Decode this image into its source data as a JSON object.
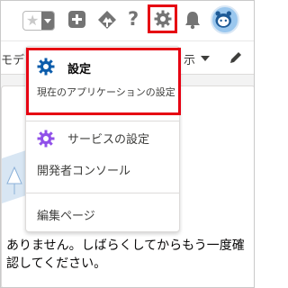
{
  "header": {
    "favorites_icon": "star-icon",
    "favorites_menu_icon": "chevron-down-icon",
    "global_actions_icon": "plus-icon",
    "trailhead_icon": "trailhead-icon",
    "help_icon": "question-icon",
    "help_glyph": "?",
    "setup_icon": "gear-icon",
    "notifications_icon": "bell-icon",
    "avatar_icon": "astro-avatar-icon"
  },
  "nav": {
    "left_label": "モデー",
    "right_label": "示",
    "edit_icon": "pencil-icon"
  },
  "setup_menu": {
    "items": [
      {
        "label": "設定",
        "description": "現在のアプリケーションの設定",
        "icon": "gear-icon",
        "icon_color": "#0b5cab"
      },
      {
        "label": "サービスの設定",
        "icon": "gear-icon",
        "icon_color": "#9050e9"
      },
      {
        "label": "開発者コンソール"
      },
      {
        "label": "編集ページ"
      }
    ]
  },
  "content": {
    "empty_message": "ありません。しばらくしてからもう一度確認してください。"
  },
  "colors": {
    "highlight": "#e60012",
    "icon_gray": "#747474",
    "setup_blue": "#0b5cab",
    "service_purple": "#9050e9"
  }
}
